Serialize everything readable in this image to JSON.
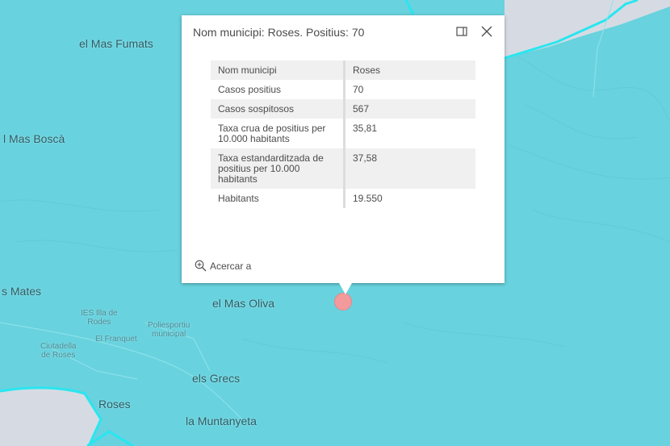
{
  "map": {
    "labels": [
      {
        "id": "mas-fumats",
        "text": "el Mas Fumats"
      },
      {
        "id": "mas-bosca",
        "text": "l Mas Boscà"
      },
      {
        "id": "mates",
        "text": "s Mates"
      },
      {
        "id": "mas-oliva",
        "text": "el Mas Oliva"
      },
      {
        "id": "ies",
        "text": "IES Illa de\nRodes"
      },
      {
        "id": "poliesportiu",
        "text": "Poliesportiu\nmunicipal"
      },
      {
        "id": "franquet",
        "text": "El Franquet"
      },
      {
        "id": "ciutadella",
        "text": "Ciutadella\nde Roses"
      },
      {
        "id": "grecs",
        "text": "els Grecs"
      },
      {
        "id": "roses",
        "text": "Roses"
      },
      {
        "id": "muntanyeta",
        "text": "la Muntanyeta"
      }
    ],
    "colors": {
      "area": "#68d2de",
      "land": "#d6dbe3",
      "boundary": "#28e6f0",
      "marker": "#f29a9c"
    }
  },
  "popup": {
    "title": "Nom municipi: Roses. Positius: 70",
    "dock_icon": "dock-icon",
    "close_icon": "close-icon",
    "attributes": [
      {
        "key": "Nom municipi",
        "value": "Roses"
      },
      {
        "key": "Casos positius",
        "value": "70"
      },
      {
        "key": "Casos sospitosos",
        "value": "567"
      },
      {
        "key": "Taxa crua de positius per 10.000 habitants",
        "value": "35,81"
      },
      {
        "key": "Taxa estandarditzada de positius per 10.000 habitants",
        "value": "37,58"
      },
      {
        "key": "Habitants",
        "value": "19.550"
      }
    ],
    "zoom_action": {
      "icon": "zoom-in-icon",
      "label": "Acercar a"
    }
  }
}
